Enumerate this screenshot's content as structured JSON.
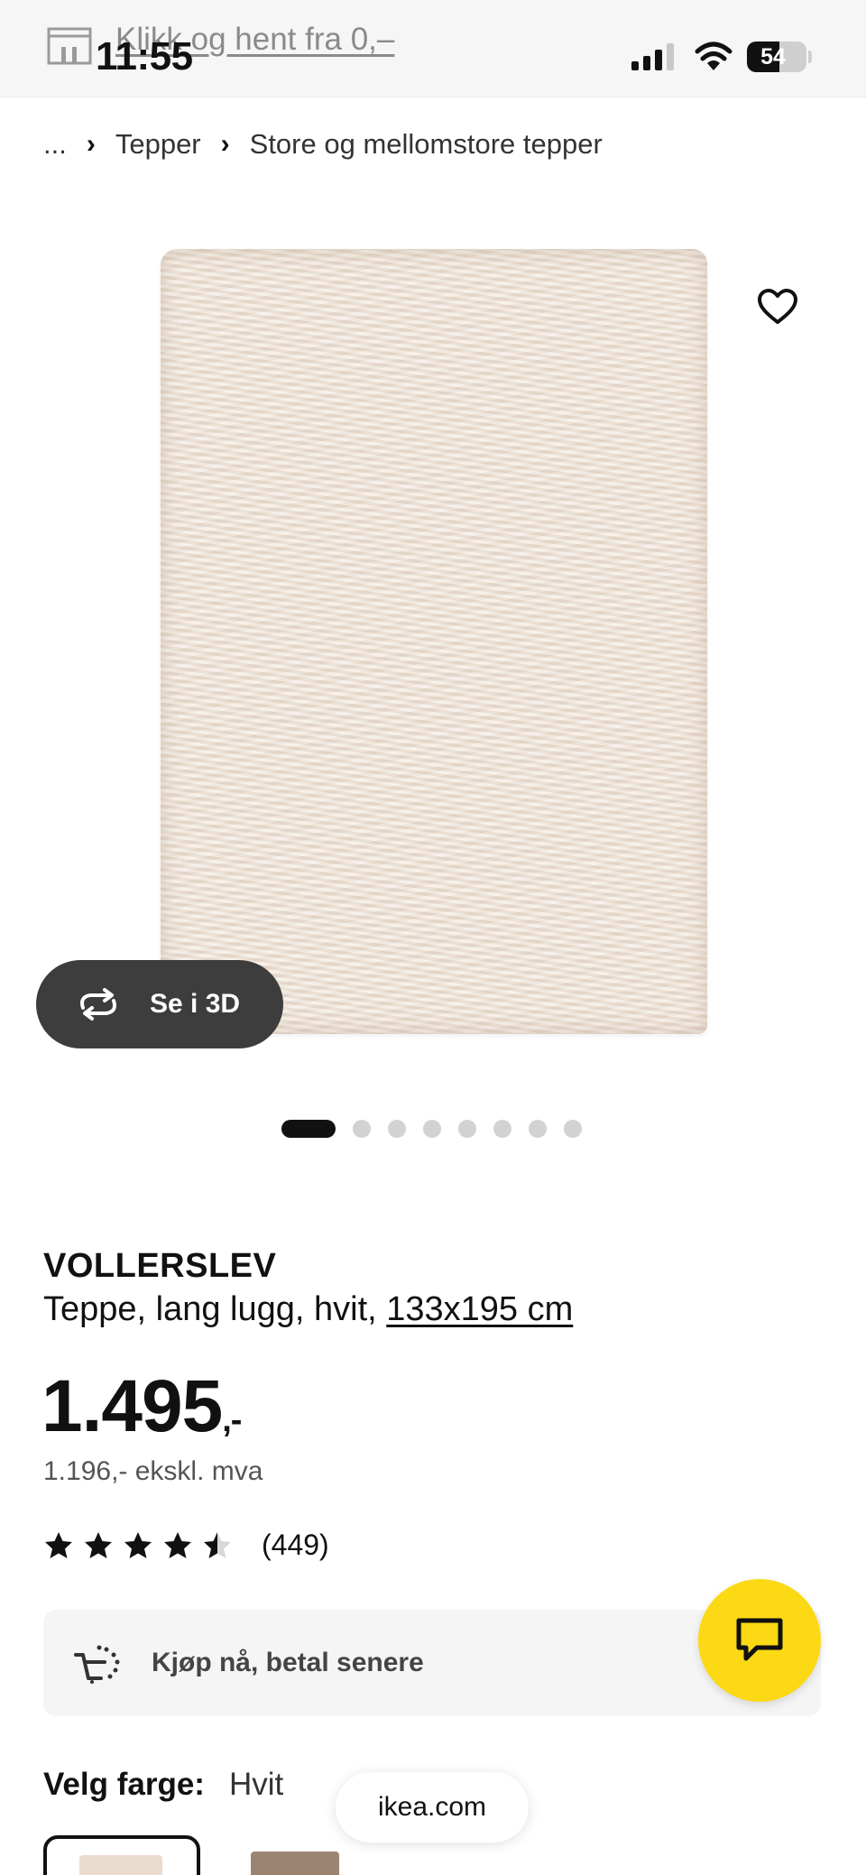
{
  "status_bar": {
    "time": "11:55",
    "battery_percent": "54",
    "battery_level": 0.54
  },
  "promo": {
    "text": "Klikk og hent fra 0,–",
    "icon": "store-icon"
  },
  "breadcrumb": {
    "ellipsis": "...",
    "items": [
      "Tepper",
      "Store og mellomstore tepper"
    ]
  },
  "gallery": {
    "see_3d_label": "Se i 3D",
    "image_count": 8,
    "active_index": 0
  },
  "product": {
    "name": "VOLLERSLEV",
    "description": "Teppe, lang lugg, hvit,",
    "size": "133x195 cm",
    "price": "1.495",
    "price_suffix": ",-",
    "price_ex_vat": "1.196,- ekskl. mva",
    "rating": 4.5,
    "review_count": "(449)"
  },
  "buy_now": {
    "label": "Kjøp nå, betal senere"
  },
  "color": {
    "label": "Velg farge:",
    "selected": "Hvit",
    "swatches": [
      {
        "color": "#eadbcf"
      },
      {
        "color": "#9c8472"
      }
    ]
  },
  "browser": {
    "url": "ikea.com"
  },
  "colors": {
    "chat_button": "#fbd914",
    "see_3d_button": "#3d3d3d",
    "rug": "#efe2d6"
  }
}
